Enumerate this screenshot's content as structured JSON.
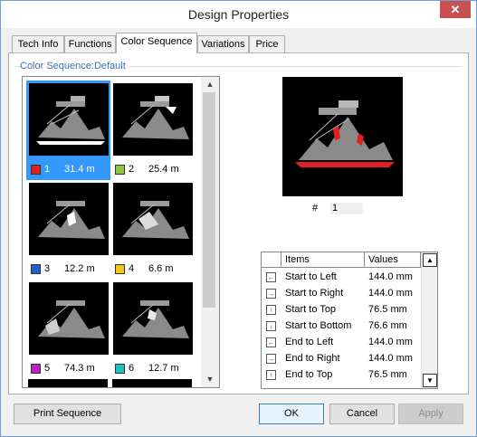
{
  "window": {
    "title": "Design Properties"
  },
  "tabs": [
    {
      "label": "Tech Info"
    },
    {
      "label": "Functions"
    },
    {
      "label": "Color Sequence"
    },
    {
      "label": "Variations"
    },
    {
      "label": "Price"
    }
  ],
  "active_tab": "Color Sequence",
  "group": {
    "label": "Color Sequence:Default"
  },
  "thumbnails": [
    {
      "index": "1",
      "length": "31.4 m",
      "color": "#e02020",
      "selected": true
    },
    {
      "index": "2",
      "length": "25.4 m",
      "color": "#8bc53f",
      "selected": false
    },
    {
      "index": "3",
      "length": "12.2 m",
      "color": "#2060c8",
      "selected": false
    },
    {
      "index": "4",
      "length": "6.6 m",
      "color": "#f5c518",
      "selected": false
    },
    {
      "index": "5",
      "length": "74.3 m",
      "color": "#c020c0",
      "selected": false
    },
    {
      "index": "6",
      "length": "12.7 m",
      "color": "#20c0c0",
      "selected": false
    }
  ],
  "preview": {
    "hash_label": "#",
    "number": "1"
  },
  "table": {
    "headers": {
      "items": "Items",
      "values": "Values"
    },
    "rows": [
      {
        "icon": "arrow-left-icon",
        "item": "Start to Left",
        "value": "144.0 mm"
      },
      {
        "icon": "arrow-right-icon",
        "item": "Start to Right",
        "value": "144.0 mm"
      },
      {
        "icon": "arrow-up-icon",
        "item": "Start to Top",
        "value": "76.5 mm"
      },
      {
        "icon": "arrow-down-icon",
        "item": "Start to Bottom",
        "value": "76.6 mm"
      },
      {
        "icon": "arrow-left-red-icon",
        "item": "End to Left",
        "value": "144.0 mm"
      },
      {
        "icon": "arrow-right-red-icon",
        "item": "End to Right",
        "value": "144.0 mm"
      },
      {
        "icon": "arrow-up-red-icon",
        "item": "End to Top",
        "value": "76.5 mm"
      }
    ]
  },
  "buttons": {
    "print_sequence": "Print Sequence",
    "ok": "OK",
    "cancel": "Cancel",
    "apply": "Apply"
  },
  "close_glyph": "✕"
}
